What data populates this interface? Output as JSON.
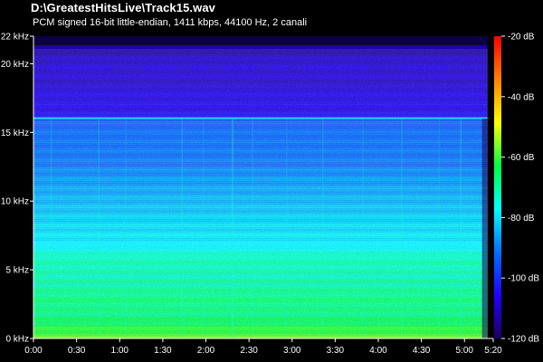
{
  "chart_data": {
    "type": "heatmap",
    "title": "D:\\GreatestHitsLive\\Track15.wav",
    "subtitle": "PCM signed 16-bit little-endian, 1411 kbps, 44100 Hz, 2 canali",
    "xlabel": "",
    "ylabel": "",
    "x": {
      "unit": "seconds",
      "range": [
        0,
        320
      ],
      "ticks": [
        {
          "value": 0,
          "label": "0:00"
        },
        {
          "value": 30,
          "label": "0:30"
        },
        {
          "value": 60,
          "label": "1:00"
        },
        {
          "value": 90,
          "label": "1:30"
        },
        {
          "value": 120,
          "label": "2:00"
        },
        {
          "value": 150,
          "label": "2:30"
        },
        {
          "value": 180,
          "label": "3:00"
        },
        {
          "value": 210,
          "label": "3:30"
        },
        {
          "value": 240,
          "label": "4:00"
        },
        {
          "value": 270,
          "label": "4:30"
        },
        {
          "value": 300,
          "label": "5:00"
        },
        {
          "value": 320,
          "label": "5:20"
        }
      ]
    },
    "y": {
      "unit": "kHz",
      "range": [
        0,
        22
      ],
      "ticks": [
        {
          "value": 0,
          "label": "0 kHz"
        },
        {
          "value": 5,
          "label": "5 kHz"
        },
        {
          "value": 10,
          "label": "10 kHz"
        },
        {
          "value": 15,
          "label": "15 kHz"
        },
        {
          "value": 20,
          "label": "20 kHz"
        },
        {
          "value": 22,
          "label": "22 kHz"
        }
      ]
    },
    "colorbar": {
      "unit": "dB",
      "range": [
        -120,
        -20
      ],
      "ticks": [
        {
          "value": -20,
          "label": "-20 dB"
        },
        {
          "value": -40,
          "label": "-40 dB"
        },
        {
          "value": -60,
          "label": "-60 dB"
        },
        {
          "value": -80,
          "label": "-80 dB"
        },
        {
          "value": -100,
          "label": "-100 dB"
        },
        {
          "value": -120,
          "label": "-120 dB"
        }
      ],
      "colors": [
        "#1a0060",
        "#2000ff",
        "#0070ff",
        "#00ffff",
        "#00ff40",
        "#ffff00",
        "#ff8000",
        "#ff0000"
      ]
    },
    "audio_end_time": 316,
    "cutoff_frequency_khz": 16,
    "level_profile": [
      {
        "khz": 0,
        "db": -58
      },
      {
        "khz": 1,
        "db": -63
      },
      {
        "khz": 2,
        "db": -68
      },
      {
        "khz": 4,
        "db": -70
      },
      {
        "khz": 6,
        "db": -74
      },
      {
        "khz": 7,
        "db": -78
      },
      {
        "khz": 10,
        "db": -84
      },
      {
        "khz": 13,
        "db": -91
      },
      {
        "khz": 15.8,
        "db": -93
      },
      {
        "khz": 16.2,
        "db": -106
      },
      {
        "khz": 20,
        "db": -110
      },
      {
        "khz": 22,
        "db": -116
      }
    ]
  }
}
